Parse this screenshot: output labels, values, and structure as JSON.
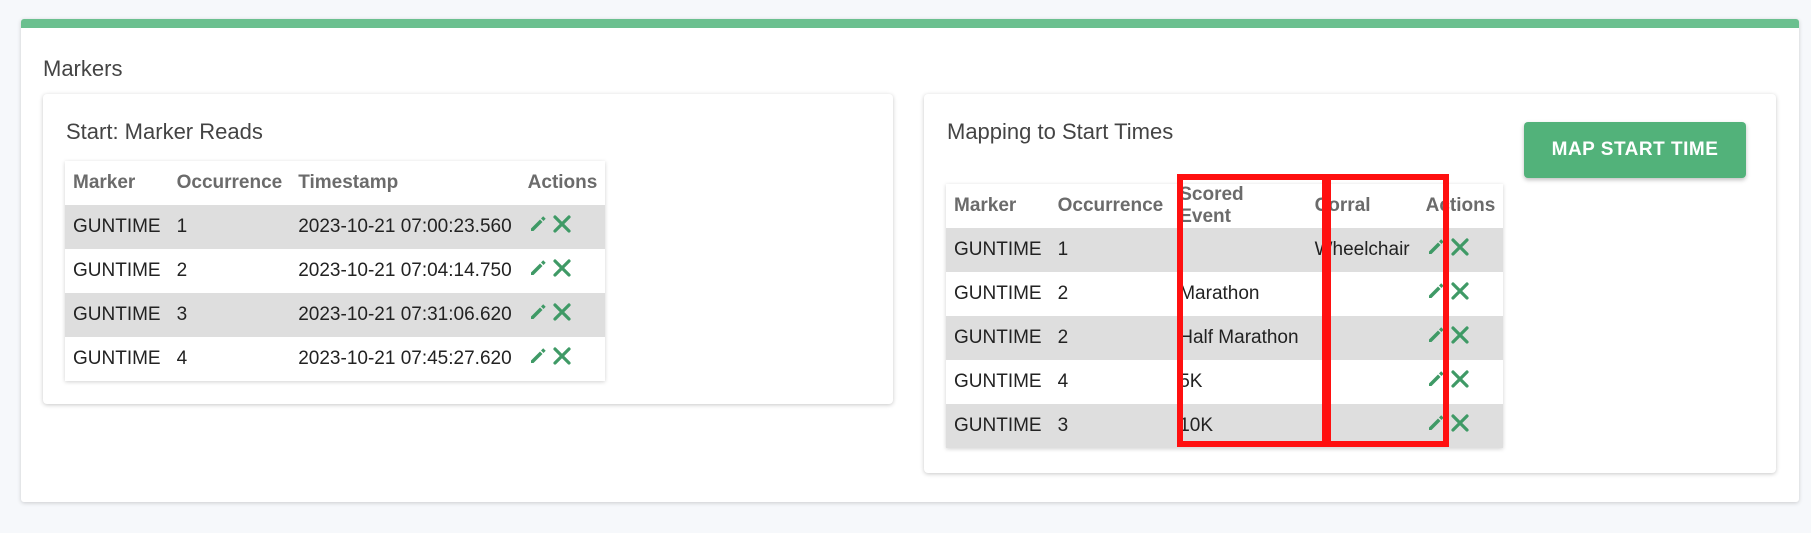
{
  "markers": {
    "title": "Markers",
    "reads": {
      "title": "Start: Marker Reads",
      "columns": [
        "Marker",
        "Occurrence",
        "Timestamp",
        "Actions"
      ],
      "rows": [
        {
          "marker": "GUNTIME",
          "occurrence": "1",
          "timestamp": "2023-10-21 07:00:23.560"
        },
        {
          "marker": "GUNTIME",
          "occurrence": "2",
          "timestamp": "2023-10-21 07:04:14.750"
        },
        {
          "marker": "GUNTIME",
          "occurrence": "3",
          "timestamp": "2023-10-21 07:31:06.620"
        },
        {
          "marker": "GUNTIME",
          "occurrence": "4",
          "timestamp": "2023-10-21 07:45:27.620"
        }
      ]
    },
    "mapping": {
      "title": "Mapping to Start Times",
      "button_label": "MAP START TIME",
      "columns": [
        "Marker",
        "Occurrence",
        "Scored Event",
        "Corral",
        "Actions"
      ],
      "rows": [
        {
          "marker": "GUNTIME",
          "occurrence": "1",
          "event": "",
          "corral": "Wheelchair"
        },
        {
          "marker": "GUNTIME",
          "occurrence": "2",
          "event": "Marathon",
          "corral": ""
        },
        {
          "marker": "GUNTIME",
          "occurrence": "2",
          "event": "Half Marathon",
          "corral": ""
        },
        {
          "marker": "GUNTIME",
          "occurrence": "4",
          "event": "5K",
          "corral": ""
        },
        {
          "marker": "GUNTIME",
          "occurrence": "3",
          "event": "10K",
          "corral": ""
        }
      ]
    }
  },
  "icons": {
    "edit": "pencil-icon",
    "delete": "close-icon"
  },
  "colors": {
    "accent": "#6bc08f",
    "button": "#52b27a",
    "action_icon": "#3f9a66",
    "highlight": "#ff1010",
    "row_stripe": "#dedede"
  }
}
